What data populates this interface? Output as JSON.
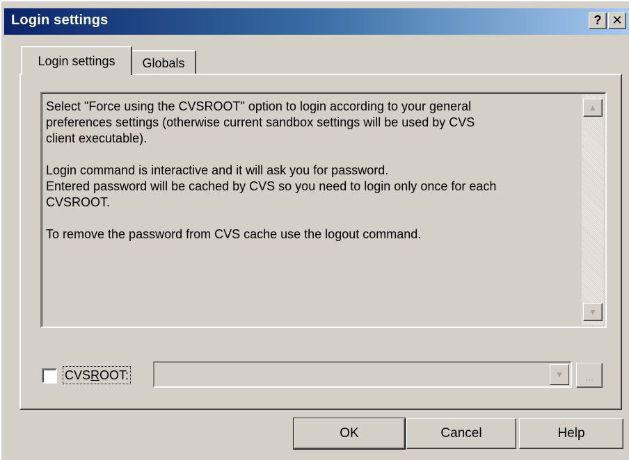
{
  "window": {
    "title": "Login settings",
    "help_glyph": "?",
    "close_glyph": "✕"
  },
  "tabs": [
    {
      "label": "Login settings",
      "active": true
    },
    {
      "label": "Globals",
      "active": false
    }
  ],
  "info": {
    "text": "Select \"Force using the CVSROOT\" option to login according to your general\npreferences settings (otherwise current sandbox settings will be used by CVS\nclient executable).\n\nLogin command is interactive and it will ask you for password.\nEntered password will be cached by CVS so you need to login only once for each\nCVSROOT.\n\nTo remove the password from CVS cache use the logout command."
  },
  "cvsroot": {
    "label_before": "CVS",
    "label_mnemonic": "R",
    "label_after": "OOT:",
    "checked": false,
    "value": "",
    "browse_label": "..."
  },
  "scroll": {
    "up_glyph": "▲",
    "down_glyph": "▼",
    "combo_glyph": "▼"
  },
  "buttons": {
    "ok": "OK",
    "cancel": "Cancel",
    "help": "Help"
  }
}
